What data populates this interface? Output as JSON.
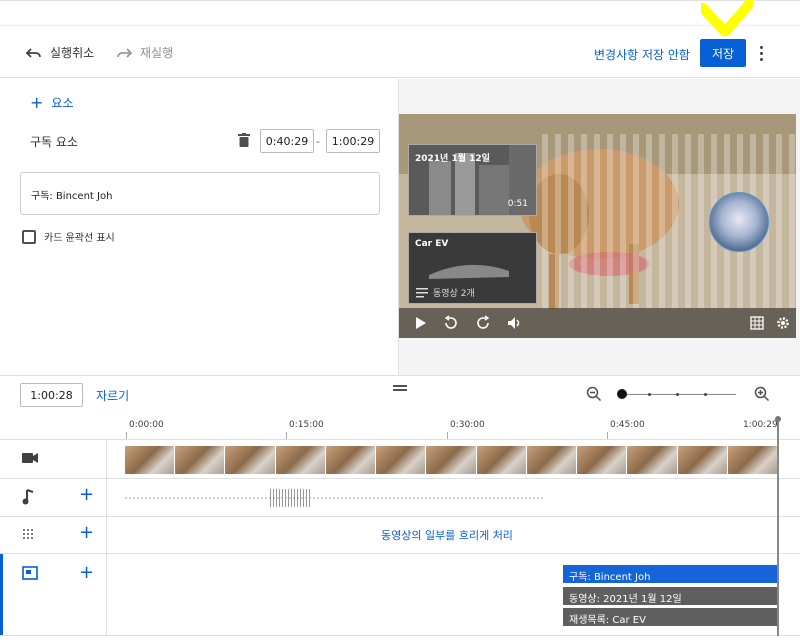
{
  "header": {
    "undo_label": "실행취소",
    "redo_label": "재실행",
    "discard_label": "변경사항 저장 안함",
    "save_label": "저장"
  },
  "editor": {
    "add_element_label": "요소",
    "element_title": "구독 요소",
    "start_time": "0:40:29",
    "time_separator": "-",
    "end_time": "1:00:29",
    "text_field_value": "구독: Bincent Joh",
    "checkbox_label": "카드 윤곽선 표시"
  },
  "preview": {
    "card1_title": "2021년 1월 12일",
    "card1_duration": "0:51",
    "card2_title": "Car EV",
    "card2_subtitle": "동영상 2개"
  },
  "timeline": {
    "current_time": "1:00:28",
    "trim_label": "자르기",
    "ruler": [
      "0:00:00",
      "0:15:00",
      "0:30:00",
      "0:45:00",
      "1:00:29"
    ],
    "blur_label": "동영상의 일부를 흐리게 처리",
    "end_screen_items": [
      "구독: Bincent Joh",
      "동영상: 2021년 1월 12일",
      "재생목록: Car EV"
    ]
  },
  "colors": {
    "accent": "#065fd4",
    "highlight": "#ffff00"
  },
  "icons": [
    "undo-icon",
    "redo-icon",
    "more-vert-icon",
    "plus-icon",
    "trash-icon",
    "play-icon",
    "rewind-10-icon",
    "forward-10-icon",
    "volume-icon",
    "grid-icon",
    "settings-icon",
    "zoom-out-icon",
    "zoom-in-icon",
    "video-track-icon",
    "audio-track-icon",
    "blur-track-icon",
    "end-screen-track-icon"
  ]
}
